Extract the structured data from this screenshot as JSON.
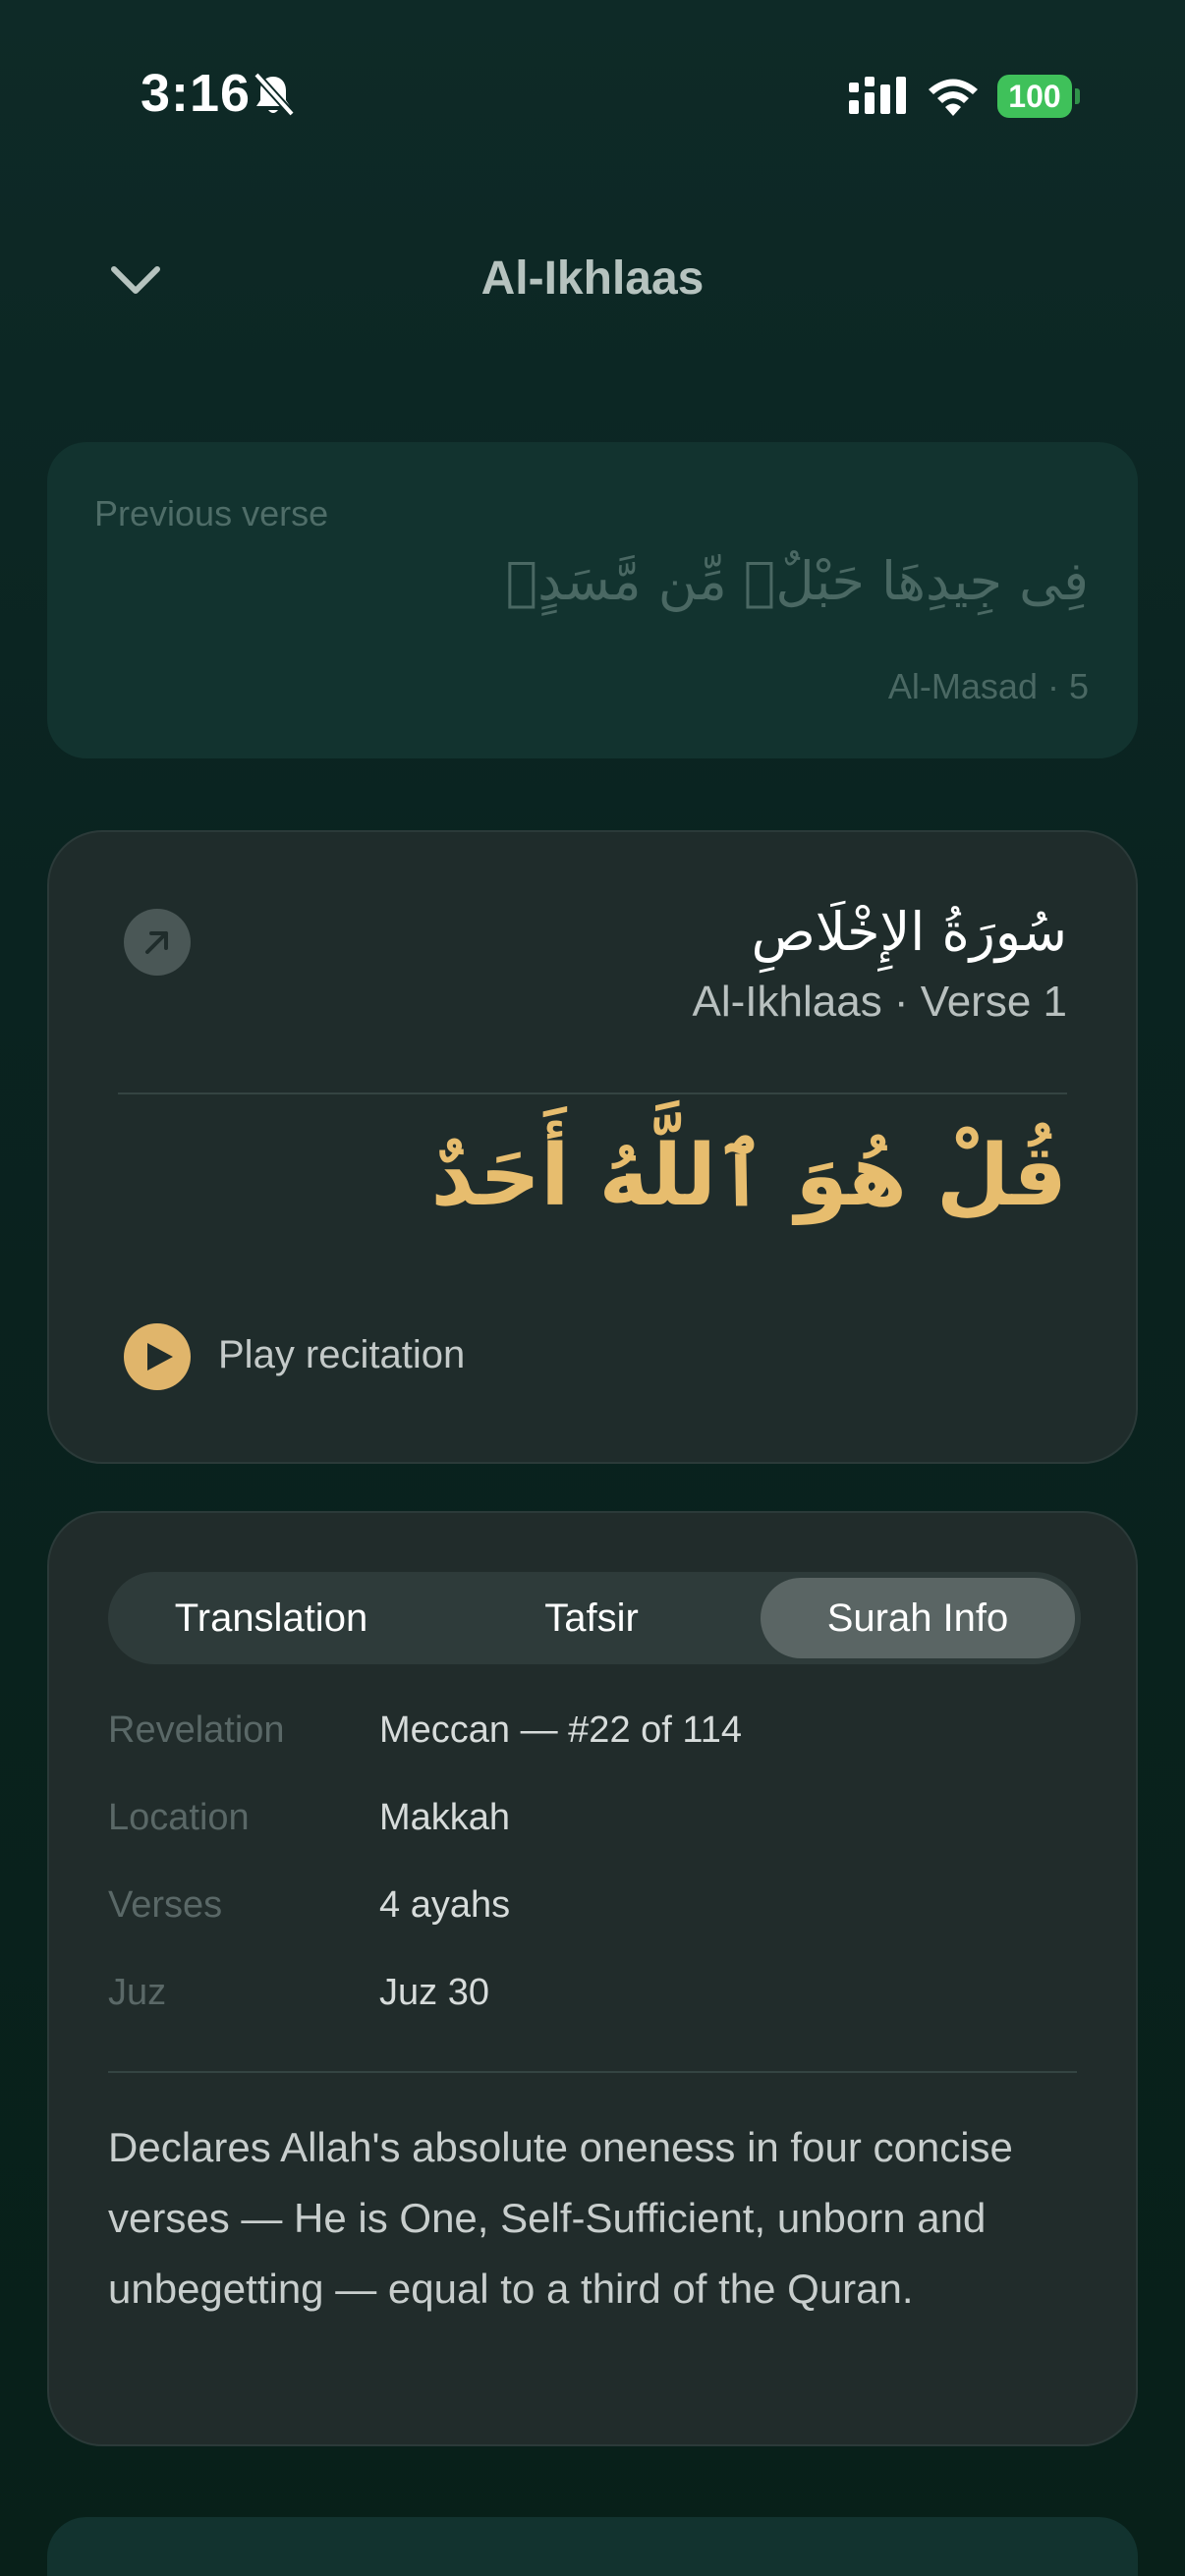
{
  "status_bar": {
    "time": "3:16",
    "battery": "100",
    "battery_color": "#3fc15a"
  },
  "header": {
    "title": "Al-Ikhlaas",
    "back_icon": "chevron-down-icon"
  },
  "previous_verse": {
    "label": "Previous verse",
    "arabic": "فِى جِيدِهَا حَبْلٌۭ مِّن مَّسَدٍۭ",
    "reference": "Al-Masad · 5"
  },
  "current_verse": {
    "surah_arabic": "سُورَةُ الإِخْلَاصِ",
    "reference": "Al-Ikhlaas · Verse 1",
    "arabic": "قُلْ هُوَ ٱللَّهُ أَحَدٌ",
    "play_label": "Play recitation",
    "accent_color": "#e0b56b"
  },
  "tabs": [
    {
      "label": "Translation",
      "active": false
    },
    {
      "label": "Tafsir",
      "active": false
    },
    {
      "label": "Surah Info",
      "active": true
    }
  ],
  "surah_info": {
    "rows": [
      {
        "label": "Revelation",
        "value": "Meccan — #22 of 114"
      },
      {
        "label": "Location",
        "value": "Makkah"
      },
      {
        "label": "Verses",
        "value": "4 ayahs"
      },
      {
        "label": "Juz",
        "value": "Juz 30"
      }
    ],
    "description": "Declares Allah's absolute oneness in four concise verses — He is One, Self-Sufficient, unborn and unbegetting — equal to a third of the Quran."
  }
}
